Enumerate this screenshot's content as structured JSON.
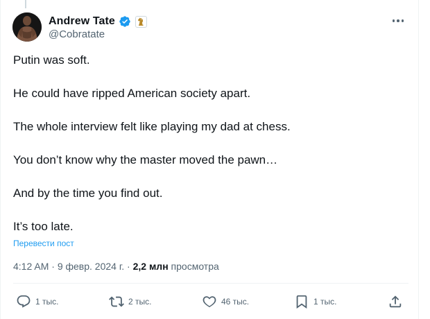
{
  "author": {
    "display_name": "Andrew Tate",
    "handle": "@Cobratate"
  },
  "tweet": {
    "lines": [
      "Putin was soft.",
      "He could have ripped American society apart.",
      "The whole interview felt like playing my dad at chess.",
      "You don’t know why the master moved the pawn…",
      "And by the time you find out.",
      "It’s too late."
    ],
    "translate_link": "Перевести пост"
  },
  "meta": {
    "time": "4:12 AM",
    "separator": "·",
    "date": "9 февр. 2024 г.",
    "views_count": "2,2 млн",
    "views_label": "просмотра"
  },
  "actions": {
    "replies": "1 тыс.",
    "reposts": "2 тыс.",
    "likes": "46 тыс.",
    "bookmarks": "1 тыс."
  },
  "icons": {
    "verified": "verified-badge-icon",
    "affiliate": "chess-knight-icon",
    "more": "more-icon",
    "reply": "reply-icon",
    "repost": "repost-icon",
    "like": "heart-icon",
    "bookmark": "bookmark-icon",
    "share": "share-icon"
  },
  "colors": {
    "text": "#0f1419",
    "secondary": "#536471",
    "link": "#1d9bf0",
    "border": "#eff3f4"
  }
}
